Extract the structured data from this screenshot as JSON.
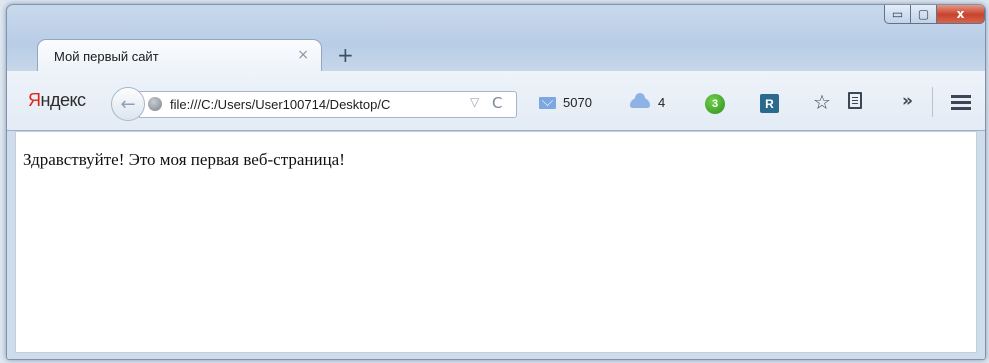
{
  "tab": {
    "title": "Мой первый сайт",
    "close_glyph": "×",
    "new_tab_glyph": "+"
  },
  "window_controls": {
    "minimize": "▭",
    "maximize": "▢",
    "close": "x"
  },
  "toolbar": {
    "logo_first": "Я",
    "logo_rest": "ндекс",
    "back_glyph": "←",
    "address": "file:///C:/Users/User100714/Desktop/C",
    "dropdown_glyph": "▽",
    "reload_glyph": "C",
    "mail_count": "5070",
    "cloud_count": "4",
    "green_badge": "3",
    "r_icon_label": "R",
    "star_glyph": "☆",
    "overflow_glyph": "»"
  },
  "page": {
    "body_text": "Здравствуйте! Это моя первая веб-страница!"
  }
}
